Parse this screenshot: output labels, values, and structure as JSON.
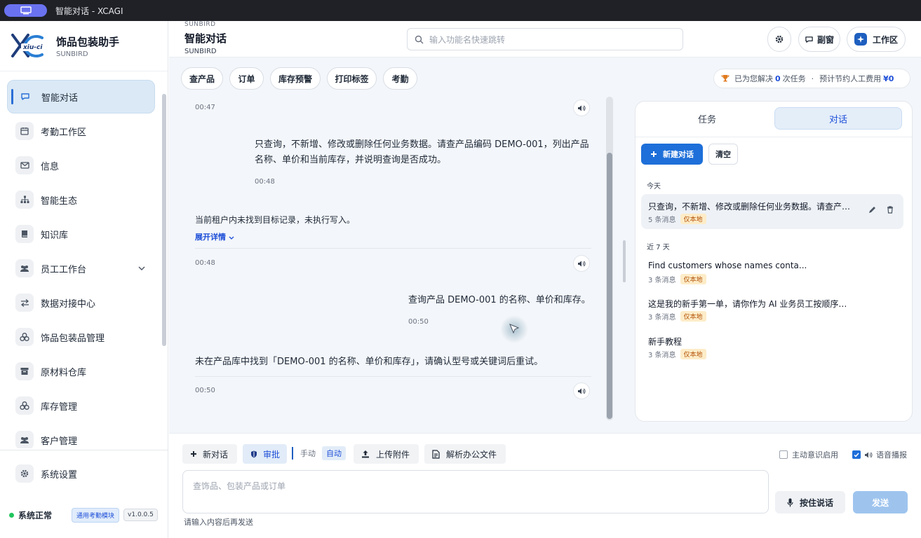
{
  "window": {
    "title": "智能对话 - XCAGI"
  },
  "brand": {
    "name": "饰品包装助手",
    "sub": "SUNBIRD",
    "logo_text": "xiu-ci"
  },
  "sidebar": {
    "items": [
      {
        "label": "智能对话",
        "icon": "chat-icon",
        "active": true
      },
      {
        "label": "考勤工作区",
        "icon": "calendar-icon"
      },
      {
        "label": "信息",
        "icon": "mail-icon"
      },
      {
        "label": "智能生态",
        "icon": "hierarchy-icon"
      },
      {
        "label": "知识库",
        "icon": "book-icon"
      },
      {
        "label": "员工工作台",
        "icon": "users-icon",
        "expandable": true
      },
      {
        "label": "数据对接中心",
        "icon": "swap-icon"
      },
      {
        "label": "饰品包装品管理",
        "icon": "cubes-icon"
      },
      {
        "label": "原材料仓库",
        "icon": "archive-icon"
      },
      {
        "label": "库存管理",
        "icon": "cubes-icon"
      },
      {
        "label": "客户管理",
        "icon": "users-icon"
      }
    ],
    "settings": "系统设置",
    "status": "系统正常",
    "module": "通用考勤模块",
    "version": "v1.0.0.5"
  },
  "header": {
    "sup": "SUNBIRD",
    "title": "智能对话",
    "sub": "SUNBIRD",
    "search_placeholder": "输入功能名快速跳转",
    "btn_side": "副窗",
    "btn_work": "工作区"
  },
  "quick": [
    "查产品",
    "订单",
    "库存预警",
    "打印标签",
    "考勤"
  ],
  "stats": {
    "prefix": "已为您解决",
    "count": "0",
    "unit": "次任务",
    "sep": "·",
    "saved_label": "预计节约人工费用",
    "saved": "¥0"
  },
  "messages": {
    "t1": "00:47",
    "u1_line1": "只查询，不新增、修改或删除任何业务数据。请查产品编码 DEMO-001，列出产品",
    "u1_line2": "名称、单价和当前库存，并说明查询是否成功。",
    "t2": "00:48",
    "a1": "当前租户内未找到目标记录，未执行写入。",
    "expand": "展开详情",
    "t3": "00:48",
    "u2": "查询产品 DEMO-001 的名称、单价和库存。",
    "t4": "00:50",
    "a2": "未在产品库中找到「DEMO-001 的名称、单价和库存」，请确认型号或关键词后重试。",
    "t5": "00:50"
  },
  "panel": {
    "tab_tasks": "任务",
    "tab_chat": "对话",
    "new": "新建对话",
    "clear": "清空",
    "today": "今天",
    "week": "近 7 天",
    "conversations": [
      {
        "title": "只查询，不新增、修改或删除任何业务数据。请查产…",
        "count": "5 条消息",
        "tag": "仅本地"
      },
      {
        "title": "Find customers whose names conta...",
        "count": "3 条消息",
        "tag": "仅本地"
      },
      {
        "title": "这是我的新手第一单，请你作为 AI 业务员工按顺序…",
        "count": "3 条消息",
        "tag": "仅本地"
      },
      {
        "title": "新手教程",
        "count": "3 条消息",
        "tag": "仅本地"
      }
    ]
  },
  "composer": {
    "new_chat": "新对话",
    "approve": "审批",
    "manual": "手动",
    "auto": "自动",
    "upload": "上传附件",
    "parse": "解析办公文件",
    "proactive": "主动意识启用",
    "voice": "语音播报",
    "placeholder": "查饰品、包装产品或订单",
    "hint": "请输入内容后再发送",
    "ptt": "按住说话",
    "send": "发送"
  }
}
